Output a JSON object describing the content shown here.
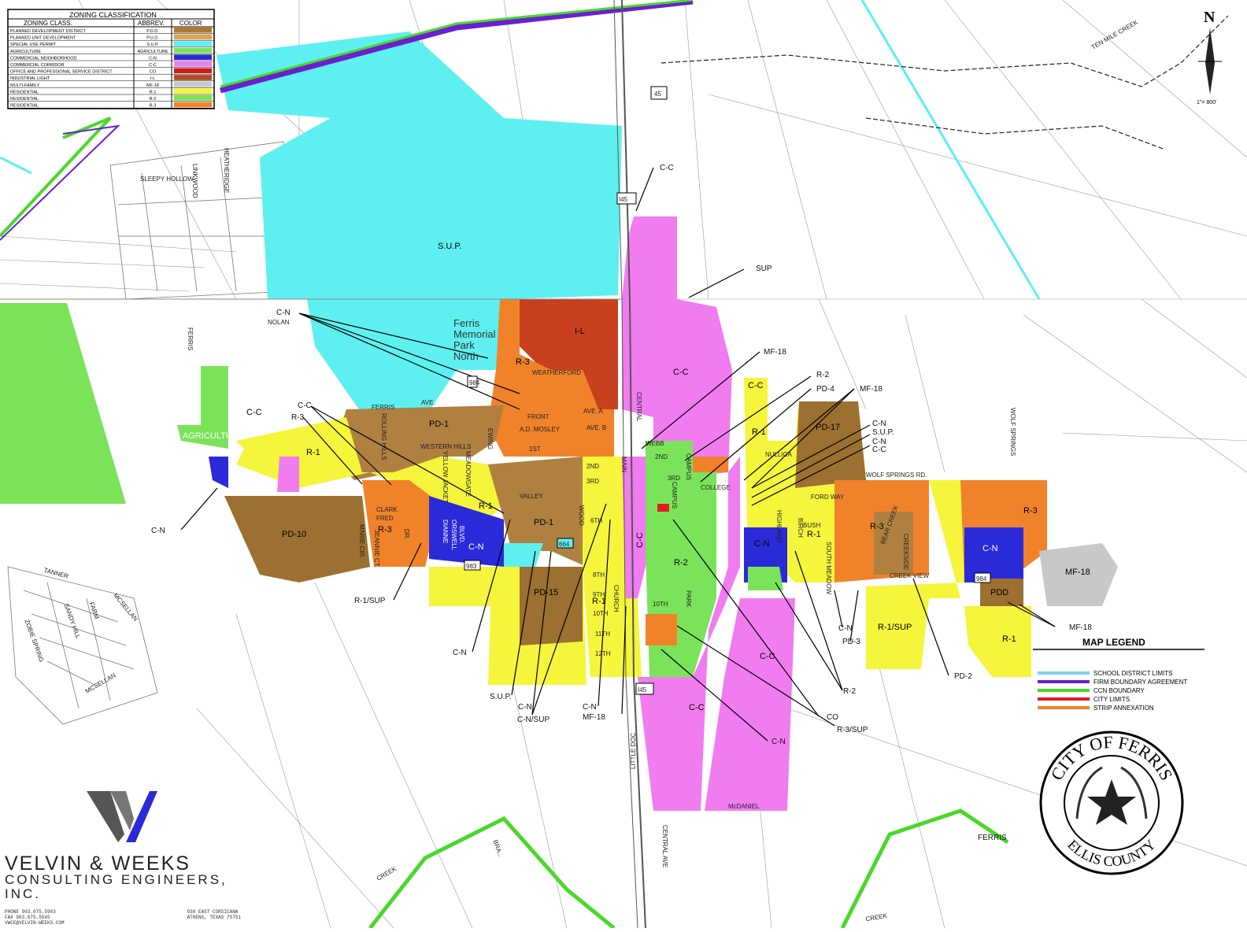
{
  "zoning_table": {
    "title": "ZONING CLASSIFICATION",
    "headers": [
      "ZONING CLASS.",
      "ABBREV.",
      "COLOR"
    ],
    "rows": [
      {
        "cls": "PLANNED DEVELOPMENT DISTRICT",
        "abbr": "P.D.D.",
        "color": "#b07a2a"
      },
      {
        "cls": "PLANNED UNIT DEVELOPMENT",
        "abbr": "P.U.D.",
        "color": "#d9a35a"
      },
      {
        "cls": "SPECIAL USE PERMIT",
        "abbr": "S.U.P.",
        "color": "#5ef0f0"
      },
      {
        "cls": "AGRICULTURE",
        "abbr": "AGRICULTURE",
        "color": "#7be35a"
      },
      {
        "cls": "COMMERCIAL NEIGHBORHOOD",
        "abbr": "C-N",
        "color": "#2a2ad8"
      },
      {
        "cls": "COMMERCIAL CORRIDOR",
        "abbr": "C-C",
        "color": "#f07cf0"
      },
      {
        "cls": "OFFICE AND PROFESSIONAL SERVICE DISTRICT",
        "abbr": "CO",
        "color": "#c81e1e"
      },
      {
        "cls": "INDUSTRIAL LIGHT",
        "abbr": "I-L",
        "color": "#b04a2a"
      },
      {
        "cls": "MULTI-FAMILY",
        "abbr": "MF-18",
        "color": "#c8c8c8"
      },
      {
        "cls": "RESIDENTIAL",
        "abbr": "R-1",
        "color": "#f5f53c"
      },
      {
        "cls": "RESIDENTIAL",
        "abbr": "R-2",
        "color": "#7be35a"
      },
      {
        "cls": "RESIDENTIAL",
        "abbr": "R-3",
        "color": "#f0832a"
      }
    ]
  },
  "map_legend": {
    "title": "MAP LEGEND",
    "items": [
      {
        "label": "SCHOOL DISTRICT LIMITS",
        "color": "#7fd0f0"
      },
      {
        "label": "FIRM BOUNDARY AGREEMENT",
        "color": "#6a1fd0"
      },
      {
        "label": "CCN BOUNDARY",
        "color": "#4ad82a"
      },
      {
        "label": "CITY LIMITS",
        "color": "#e01e1e"
      },
      {
        "label": "STRIP ANNEXATION",
        "color": "#f0832a"
      }
    ]
  },
  "north_arrow": {
    "letter": "N",
    "scale": "1\"= 800'"
  },
  "seal": {
    "top": "CITY OF FERRIS",
    "bottom": "ELLIS COUNTY"
  },
  "firm": {
    "name_line1": "VELVIN & WEEKS",
    "name_line2": "CONSULTING ENGINEERS, INC.",
    "phone": "PHONE 903.675.5903",
    "fax": "FAX 903.675.5545",
    "email": "VWCE@VELVIN-WEEKS.COM",
    "address1": "930 EAST CORSICANA",
    "address2": "ATHENS, TEXAS 75751"
  },
  "zone_labels": [
    "S.U.P.",
    "I-L",
    "C-C",
    "R-3",
    "PD-1",
    "R-1",
    "PD-10",
    "C-N",
    "PD-15",
    "R-2",
    "PD-17",
    "R-3",
    "R-3",
    "C-N",
    "MF-18",
    "PDD",
    "R-1/SUP",
    "R-1",
    "AGRICULTURE",
    "C-C",
    "C-C",
    "C-C",
    "C-C",
    "R-1",
    "R-1",
    "PD-1",
    "R-3",
    "C-C",
    "R-1",
    "C-N",
    "R-1"
  ],
  "callouts": [
    "C-C",
    "SUP",
    "C-N",
    "MF-18",
    "R-2",
    "PD-4",
    "MF-18",
    "C-C",
    "R-3",
    "C-N",
    "S.U.P.",
    "C-N",
    "C-C",
    "C-N",
    "R-1/SUP",
    "C-N",
    "S.U.P.",
    "C-N",
    "C-N/SUP",
    "C-N",
    "MF-18",
    "R-2",
    "CO",
    "R-3/SUP",
    "C-N",
    "C-N",
    "PD-3",
    "PD-2",
    "MF-18"
  ],
  "place_labels": [
    "Ferris",
    "Memorial",
    "Park",
    "North"
  ],
  "streets": [
    "SLEEPY HOLLOW",
    "LINKWOOD",
    "HEATHERIDGE",
    "NOLAN",
    "FERRIS",
    "FERRIS",
    "AVE.",
    "ROLLING HILLS",
    "WESTERN HILLS",
    "YELLOW JACKET",
    "MEADOWGATE",
    "EWING",
    "VALLEY",
    "WEATHERFORD",
    "FRONT",
    "A.D. MOSLEY",
    "1ST",
    "2ND",
    "3RD",
    "AVE. A",
    "AVE. B",
    "WEBB",
    "2ND",
    "3RD",
    "MAIN",
    "CENTRAL",
    "CAMPUS",
    "CAMPUS",
    "COLLEGE",
    "NULLICA",
    "FORD WAY",
    "BUSH",
    "BIRCH",
    "HIGHLAND",
    "SOUTH MEADOW",
    "BEAR CREEK",
    "CREEKSIDE",
    "CREEK VIEW",
    "WOLF SPRINGS",
    "WOLF SPRINGS RD.",
    "CLARK",
    "FRED",
    "MARIE CIR.",
    "JEANNIE CT.",
    "DR.",
    "DIANNE",
    "ORSWELL",
    "BLVD.",
    "WOOD",
    "6TH",
    "8TH",
    "9TH",
    "10TH",
    "11TH",
    "12TH",
    "CHURCH",
    "LITTLE DOC",
    "CENTRAL AVE",
    "McDANIEL",
    "PARK",
    "10TH",
    "TANNER",
    "SANDY HILL",
    "FARM",
    "MCSELLAN",
    "ZOBIE SPRING",
    "MCSELLAN",
    "CREEK",
    "CREEK",
    "BRA...",
    "FERRIS",
    "TEN MILE CREEK",
    "45",
    "I45",
    "983",
    "664",
    "I45",
    "984",
    "984"
  ]
}
